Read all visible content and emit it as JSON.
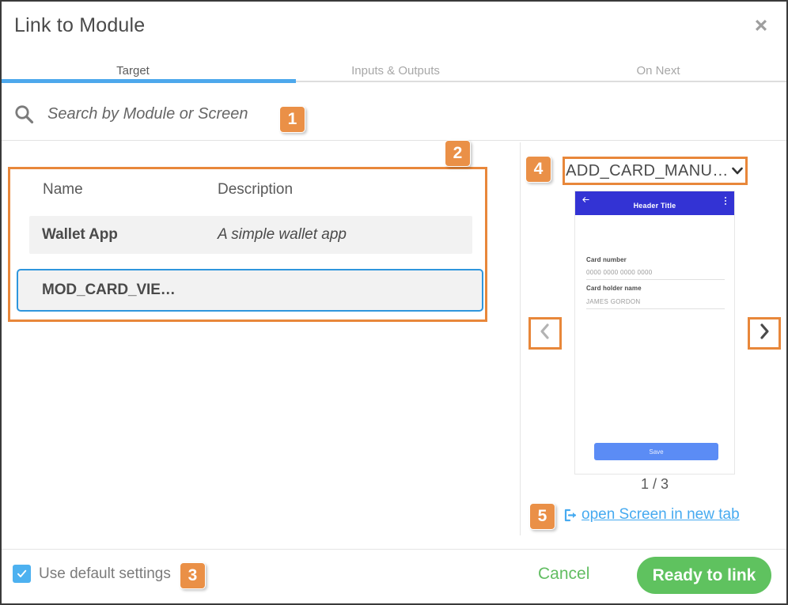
{
  "dialog": {
    "title": "Link to Module",
    "close_icon": "close-icon"
  },
  "tabs": [
    {
      "label": "Target",
      "active": true
    },
    {
      "label": "Inputs & Outputs",
      "active": false
    },
    {
      "label": "On Next",
      "active": false
    }
  ],
  "search": {
    "icon": "search-icon",
    "placeholder": "Search by Module or Screen",
    "value": ""
  },
  "badges": {
    "one": "1",
    "two": "2",
    "three": "3",
    "four": "4",
    "five": "5"
  },
  "module_list": {
    "columns": [
      "Name",
      "Description"
    ],
    "rows": [
      {
        "name": "Wallet App",
        "description": "A simple wallet app",
        "selected": false
      },
      {
        "name": "MOD_CARD_VIE…",
        "description": "",
        "selected": true
      }
    ]
  },
  "preview": {
    "screen_select": {
      "value": "ADD_CARD_MANU…",
      "chevron_icon": "chevron-down-icon"
    },
    "prev_icon": "chevron-left-icon",
    "next_icon": "chevron-right-icon",
    "pager": "1 / 3",
    "open_link": {
      "icon": "external-link-icon",
      "label": "open Screen in new tab"
    },
    "phone": {
      "back_icon": "arrow-left-icon",
      "header_title": "Header Title",
      "overflow_icon": "more-vertical-icon",
      "fields": [
        {
          "label": "Card number",
          "value": "0000 0000 0000 0000"
        },
        {
          "label": "Card holder name",
          "value": "JAMES GORDON"
        }
      ],
      "save_label": "Save"
    }
  },
  "footer": {
    "use_default_settings_label": "Use default settings",
    "use_default_settings_checked": true,
    "check_icon": "check-icon",
    "cancel_label": "Cancel",
    "ready_label": "Ready to link"
  },
  "colors": {
    "accent_blue": "#4da8ec",
    "badge_orange": "#ea9047",
    "highlight_orange": "#e8873a",
    "selection_blue": "#2f96dd",
    "primary_green": "#5fc25f",
    "link_blue": "#46aaf0",
    "phone_header_blue": "#3333d4",
    "phone_save_blue": "#5b8cf5"
  }
}
